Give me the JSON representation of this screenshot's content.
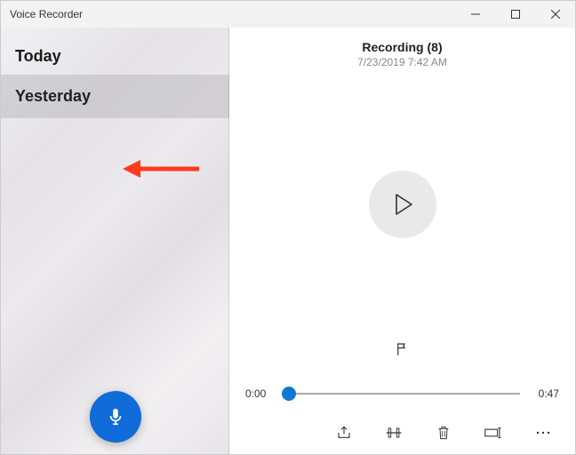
{
  "window": {
    "title": "Voice Recorder"
  },
  "sidebar": {
    "sections": [
      {
        "label": "Today",
        "selected": false
      },
      {
        "label": "Yesterday",
        "selected": true
      }
    ]
  },
  "main": {
    "recording_title": "Recording (8)",
    "recording_datetime": "7/23/2019 7:42 AM",
    "timeline": {
      "current": "0:00",
      "duration": "0:47",
      "position_pct": 2
    }
  },
  "colors": {
    "accent": "#0f78d4",
    "record": "#0f6cd8"
  }
}
